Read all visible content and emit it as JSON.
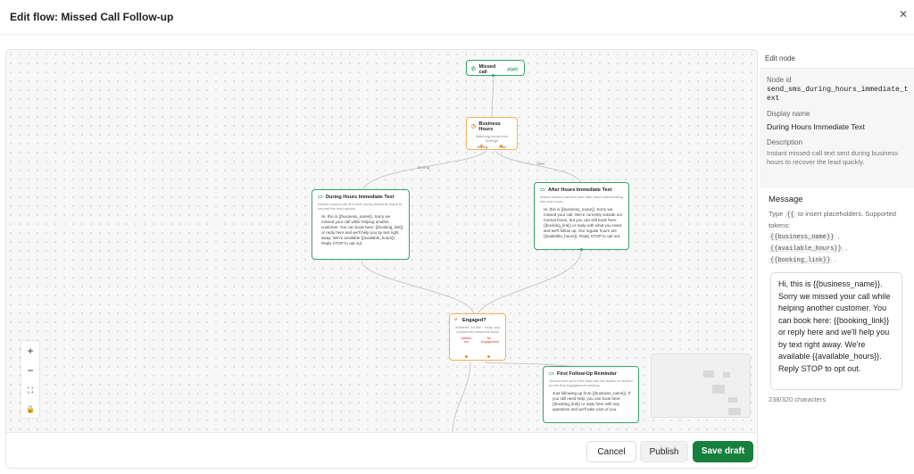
{
  "modal": {
    "title": "Edit flow: Missed Call Follow-up",
    "close_symbol": "✕"
  },
  "canvas": {
    "nodes": {
      "missed_call": {
        "title": "Missed call",
        "badge": "START"
      },
      "business_hours": {
        "title": "Business Hours",
        "subtitle": "Matching hours from Settings",
        "out_during": "During",
        "out_after": "After"
      },
      "during_text": {
        "title": "During Hours Immediate Text",
        "subtitle": "Instant missed-call text sent during business hours to recover the lead quickly.",
        "body": "Hi, this is {{business_name}}. Sorry we missed your call while helping another customer. You can book here: {{booking_link}} or reply here and we'll help you by text right away. We're available {{available_hours}}. Reply STOP to opt out."
      },
      "after_text": {
        "title": "After Hours Immediate Text",
        "subtitle": "Instant missed-call text sent after hours with booking info and hours.",
        "body": "Hi, this is {{business_name}}. Sorry we missed your call. We're currently outside our normal hours, but you can still book here: {{booking_link}} or reply with what you need and we'll follow up. Our regular hours are {{available_hours}}. Reply STOP to opt out."
      },
      "engaged": {
        "title": "Engaged?",
        "subtitle": "Whether: 10 min · reply, any Contact the business since",
        "out_yes": "Labeled Yes",
        "out_no": "No Engagement"
      },
      "followup": {
        "title": "First Follow-Up Reminder",
        "subtitle": "Second text sent if the lead has not replied or clicked on the first engagement window.",
        "body": "Just following up from {{business_name}}. If you still need help, you can book here: {{booking_link}} or reply here with any questions and we'll take care of you."
      }
    },
    "edge_labels": {
      "during": "During",
      "after": "After"
    },
    "zoom_controls": {
      "zoom_in": "+",
      "zoom_out": "−",
      "fit": "⛶",
      "lock": "🔒"
    }
  },
  "footer": {
    "cancel": "Cancel",
    "publish": "Publish",
    "save_draft": "Save draft"
  },
  "panel": {
    "header": "Edit node",
    "node_id_label": "Node id",
    "node_id_value": "send_sms_during_hours_immediate_text",
    "display_name_label": "Display name",
    "display_name_value": "During Hours Immediate Text",
    "description_label": "Description",
    "description_value": "Instant missed-call text sent during business hours to recover the lead quickly.",
    "message_label": "Message",
    "help_prefix": "Type",
    "help_braces": "{{",
    "help_suffix": "to insert placeholders. Supported tokens:",
    "tokens": [
      "{{business_name}}",
      "{{available_hours}}",
      "{{booking_link}}"
    ],
    "message_value": "Hi, this is {{business_name}}. Sorry we missed your call while helping another customer. You can book here: {{booking_link}} or reply here and we'll help you by text right away. We're available {{available_hours}}. Reply STOP to opt out.",
    "char_count": "238/320 characters"
  },
  "colors": {
    "accent_green": "#16803c",
    "node_green": "#36a36a",
    "node_orange": "#f0b25a"
  }
}
